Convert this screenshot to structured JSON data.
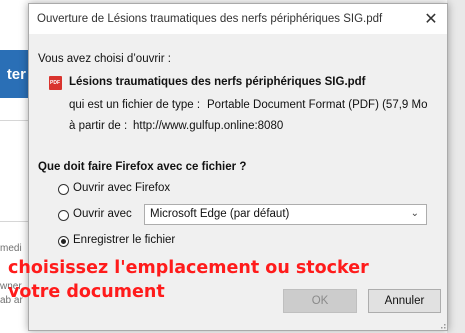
{
  "background": {
    "button_fragment": "ter",
    "text_fragments": [
      "medi",
      "wner",
      "ab ar"
    ]
  },
  "dialog": {
    "title": "Ouverture de Lésions traumatiques des nerfs périphériques SIG.pdf",
    "close_glyph": "✕",
    "intro": "Vous avez choisi d’ouvrir :",
    "file": {
      "icon": "pdf-icon",
      "name": "Lésions traumatiques des nerfs périphériques SIG.pdf",
      "type_label": "qui est un fichier de type :",
      "type_value": "Portable Document Format (PDF) (57,9 Mo",
      "from_label": "à partir de :",
      "from_value": "http://www.gulfup.online:8080"
    },
    "question": "Que doit faire Firefox avec ce fichier ?",
    "options": {
      "open_with_firefox": "Ouvrir avec Firefox",
      "open_with": "Ouvrir avec",
      "save_file": "Enregistrer le fichier",
      "selected": "save_file"
    },
    "app_select": {
      "value": "Microsoft Edge (par défaut)"
    },
    "buttons": {
      "ok": "OK",
      "cancel": "Annuler"
    }
  },
  "annotation": {
    "text": "choisissez l'emplacement ou stocker votre document",
    "color": "#ff1b1b"
  }
}
